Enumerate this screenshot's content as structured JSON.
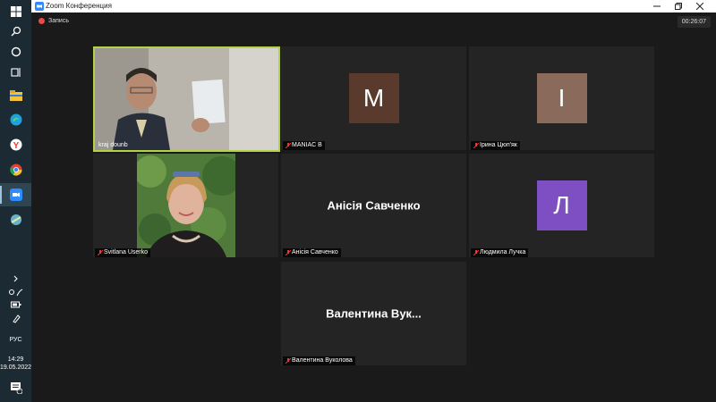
{
  "window": {
    "title": "Zoom Конференция"
  },
  "meeting": {
    "recording_label": "Запись",
    "elapsed_time": "00:26:07"
  },
  "tiles": [
    {
      "name": "kraj dounb",
      "video": true,
      "muted": false,
      "active_speaker": true
    },
    {
      "name": "MANIAC B",
      "avatar_letter": "M",
      "avatar_color": "#5b3a2e",
      "muted": true
    },
    {
      "name": "Ірина Цюп'як",
      "avatar_letter": "І",
      "avatar_color": "#8a6a5a",
      "muted": true
    },
    {
      "name": "Svitlana Userko",
      "video": true,
      "muted": true
    },
    {
      "name": "Анісія Савченко",
      "display_text": "Анісія Савченко",
      "muted": true
    },
    {
      "name": "Людмила Лучка",
      "avatar_letter": "Л",
      "avatar_color": "#7e4fc2",
      "muted": true
    },
    {
      "name": "Валентина Вуколова",
      "display_text": "Валентина Вук...",
      "muted": true
    }
  ],
  "taskbar": {
    "icons": [
      "windows-start-icon",
      "search-icon",
      "cortana-icon",
      "task-view-icon",
      "file-explorer-icon",
      "edge-icon",
      "yandex-browser-icon",
      "chrome-icon",
      "zoom-icon",
      "network-app-icon"
    ],
    "language": "РУС",
    "time": "14:29",
    "date": "19.05.2022",
    "notification_count": "2"
  },
  "colors": {
    "active_speaker_border": "#b3d24a",
    "mic_muted": "#e23a3a",
    "record_dot": "#e84a4a"
  }
}
